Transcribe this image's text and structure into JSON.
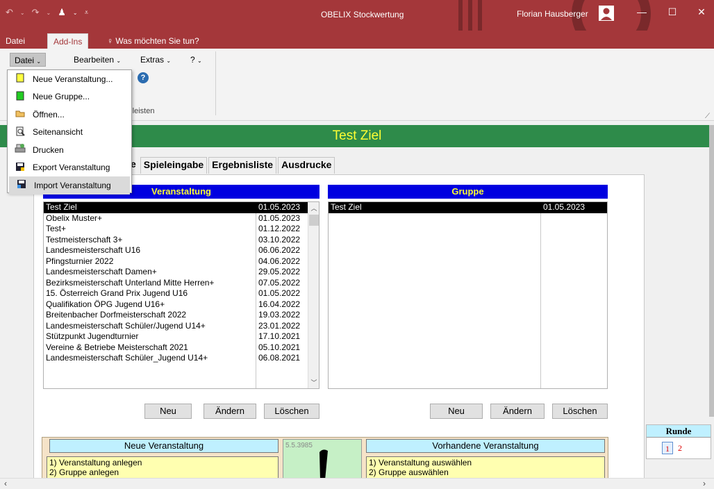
{
  "window": {
    "title": "OBELIX Stockwertung",
    "user": "Florian Hausberger",
    "brand_color": "#a4373a"
  },
  "ribbon_tabs": [
    "Datei",
    "Add-Ins"
  ],
  "tell_me": "Was möchten Sie tun?",
  "ribbon": {
    "menus": [
      "Datei",
      "Bearbeiten",
      "Extras",
      "?"
    ],
    "group_label": "bolleisten"
  },
  "dropdown": {
    "items": [
      {
        "label": "Neue Veranstaltung...",
        "icon": "new-doc-yellow-icon"
      },
      {
        "label": "Neue Gruppe...",
        "icon": "new-doc-green-icon"
      },
      {
        "label": "Öffnen...",
        "icon": "folder-open-icon"
      },
      {
        "label": "Seitenansicht",
        "icon": "print-preview-icon"
      },
      {
        "label": "Drucken",
        "icon": "printer-icon"
      },
      {
        "label": "Export Veranstaltung",
        "icon": "export-disk-icon"
      },
      {
        "label": "Import Veranstaltung",
        "icon": "import-disk-icon"
      }
    ]
  },
  "main_title": "Test Ziel",
  "page_tabs": [
    "e",
    "Spieleingabe",
    "Ergebnisliste",
    "Ausdrucke"
  ],
  "veranstaltung": {
    "header": "Veranstaltung",
    "rows": [
      {
        "name": "Test Ziel",
        "date": "01.05.2023"
      },
      {
        "name": "Obelix Muster+",
        "date": "01.05.2023"
      },
      {
        "name": "Test+",
        "date": "01.12.2022"
      },
      {
        "name": "Testmeisterschaft 3+",
        "date": "03.10.2022"
      },
      {
        "name": "Landesmeisterschaft U16",
        "date": "06.06.2022"
      },
      {
        "name": "Pfingsturnier 2022",
        "date": "04.06.2022"
      },
      {
        "name": "Landesmeisterschaft Damen+",
        "date": "29.05.2022"
      },
      {
        "name": "Bezirksmeisterschaft Unterland Mitte Herren+",
        "date": "07.05.2022"
      },
      {
        "name": "15. Österreich Grand Prix Jugend U16",
        "date": "01.05.2022"
      },
      {
        "name": "Qualifikation ÖPG Jugend U16+",
        "date": "16.04.2022"
      },
      {
        "name": "Breitenbacher Dorfmeisterschaft 2022",
        "date": "19.03.2022"
      },
      {
        "name": "Landesmeisterschaft Schüler/Jugend U14+",
        "date": "23.01.2022"
      },
      {
        "name": "Stützpunkt Jugendturnier",
        "date": "17.10.2021"
      },
      {
        "name": "Vereine & Betriebe Meisterschaft 2021",
        "date": "05.10.2021"
      },
      {
        "name": "Landesmeisterschaft Schüler_Jugend U14+",
        "date": "06.08.2021"
      }
    ],
    "buttons": [
      "Neu",
      "Ändern",
      "Löschen"
    ]
  },
  "gruppe": {
    "header": "Gruppe",
    "rows": [
      {
        "name": "Test Ziel",
        "date": "01.05.2023"
      }
    ],
    "buttons": [
      "Neu",
      "Ändern",
      "Löschen"
    ]
  },
  "info": {
    "left_header": "Neue Veranstaltung",
    "left_lines": [
      "1) Veranstaltung anlegen",
      "2) Gruppe anlegen"
    ],
    "version": "5.5.3985",
    "right_header": "Vorhandene Veranstaltung",
    "right_lines": [
      "1) Veranstaltung auswählen",
      "2) Gruppe auswählen"
    ]
  },
  "runde": {
    "label": "Runde",
    "rounds": [
      "1",
      "2"
    ]
  }
}
